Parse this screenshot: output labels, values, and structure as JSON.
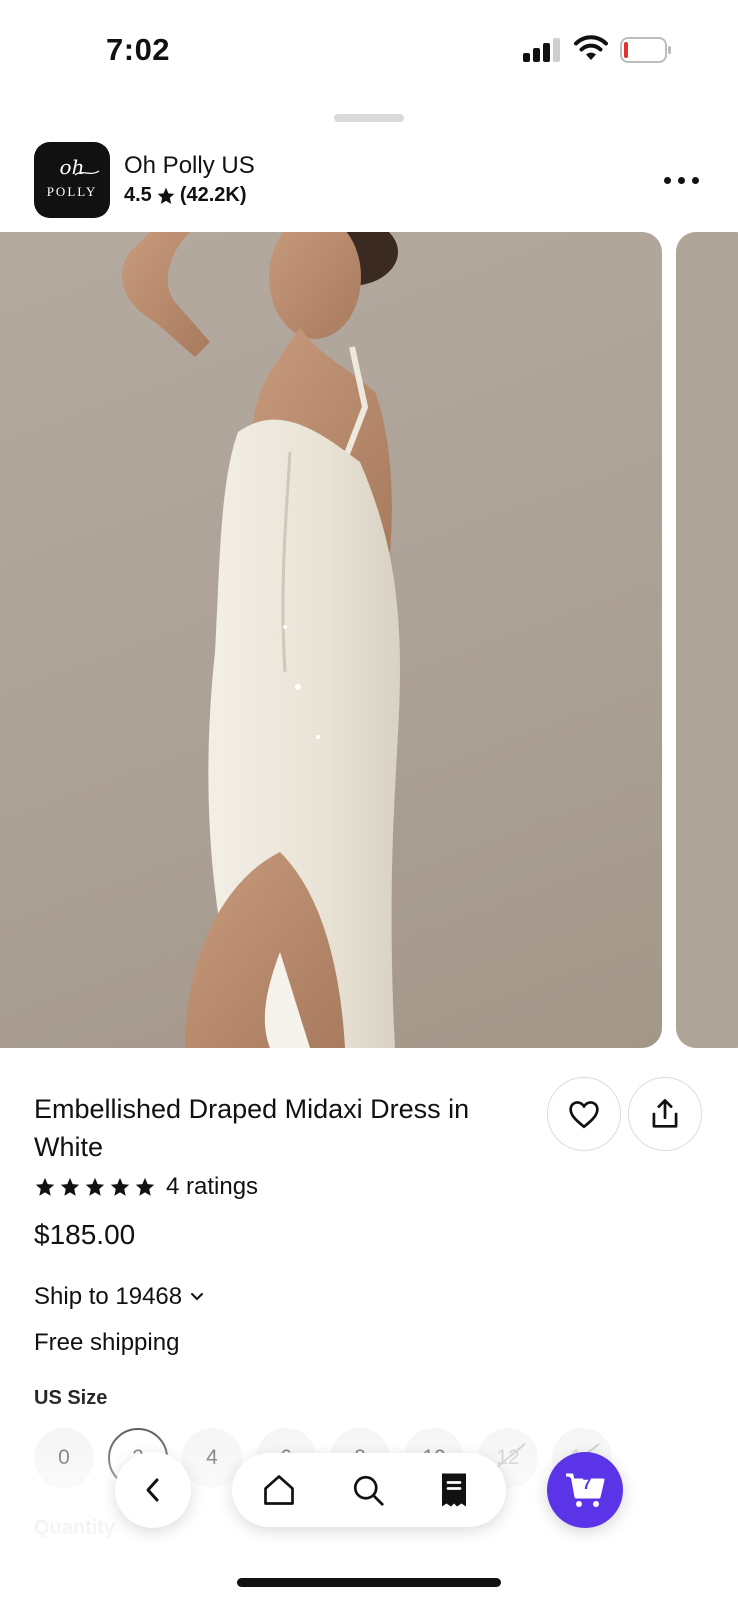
{
  "status_bar": {
    "time": "7:02",
    "icons": [
      "cellular-signal-icon",
      "wifi-icon",
      "battery-low-icon"
    ]
  },
  "store": {
    "logo_line1": "oh",
    "logo_line2": "POLLY",
    "name": "Oh Polly US",
    "rating": "4.5",
    "review_count": "(42.2K)"
  },
  "product": {
    "title": "Embellished Draped Midaxi Dress in White",
    "rating_stars": 5,
    "ratings_text": "4 ratings",
    "price": "$185.00",
    "ship_to": "Ship to 19468",
    "shipping": "Free shipping",
    "size_label": "US Size",
    "sizes": [
      {
        "label": "0",
        "state": "available"
      },
      {
        "label": "2",
        "state": "selected"
      },
      {
        "label": "4",
        "state": "available"
      },
      {
        "label": "6",
        "state": "available"
      },
      {
        "label": "8",
        "state": "available"
      },
      {
        "label": "10",
        "state": "available"
      },
      {
        "label": "12",
        "state": "unavailable"
      },
      {
        "label": "14",
        "state": "unavailable"
      }
    ],
    "quantity_label": "Quantity"
  },
  "nav": {
    "cart_count": "7",
    "icons": [
      "back-icon",
      "home-icon",
      "search-icon",
      "receipt-icon",
      "cart-icon"
    ]
  },
  "colors": {
    "accent": "#5b34e8",
    "image_background": "#aba095",
    "text": "#111111"
  }
}
